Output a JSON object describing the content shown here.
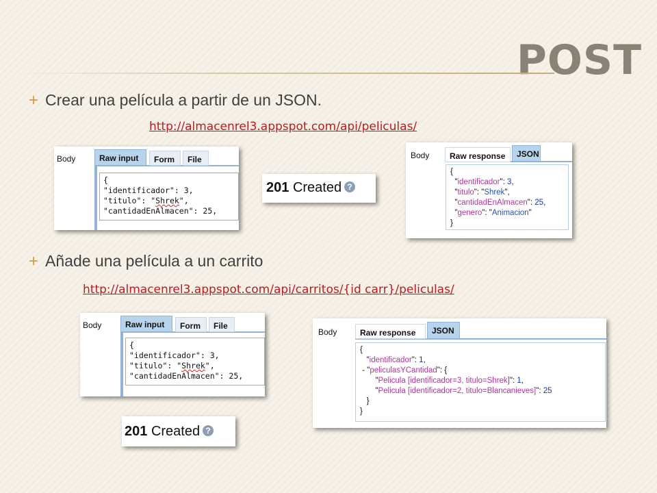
{
  "slide": {
    "title": "POST",
    "bullet1": "Crear una película a partir de un JSON.",
    "link1": "http://almacenrel3.appspot.com/api/peliculas/",
    "bullet2": "Añade una película a un carrito",
    "link2": "http://almacenrel3.appspot.com/api/carritos/{id carr}/peliculas/"
  },
  "request_tabs": {
    "body": "Body",
    "raw_input": "Raw input",
    "form": "Form",
    "file": "File"
  },
  "response_tabs": {
    "body": "Body",
    "raw_response": "Raw response",
    "json": "JSON"
  },
  "request1": {
    "brace": "{",
    "line1": "\"identificador\": 3,",
    "line2_pre": "\"titulo\": \"",
    "line2_word": "Shrek",
    "line2_post": "\",",
    "line3": "\"cantidadEnAlmacen\": 25,"
  },
  "request2": {
    "brace": "{",
    "line1": "\"identificador\": 3,",
    "line2_pre": "\"titulo\": \"",
    "line2_word": "Shrek",
    "line2_post": "\",",
    "line3": "\"cantidadEnAlmacen\": 25,"
  },
  "status": {
    "code": "201",
    "text": "Created",
    "help": "?"
  },
  "response1": {
    "open": "{",
    "k1": "identificador",
    "v1": "3",
    "k2": "titulo",
    "v2": "Shrek",
    "k3": "cantidadEnAlmacen",
    "v3": "25",
    "k4": "genero",
    "v4": "Animacion",
    "close": "}"
  },
  "response2": {
    "open": "{",
    "k1": "identificador",
    "v1": "1",
    "collapse": "-",
    "k2": "peliculasYCantidad",
    "inner_open": "{",
    "k3": "Pelicula [identificador=3, titulo=Shrek]",
    "v3": "1",
    "k4": "Pelicula [identificador=2, titulo=Blancanieves]",
    "v4": "25",
    "inner_close": "}",
    "close": "}"
  },
  "colors": {
    "title": "#8a8275",
    "bullet_marker": "#d59a45",
    "link": "#c0181d",
    "active_tab": "#b8d3ec"
  }
}
